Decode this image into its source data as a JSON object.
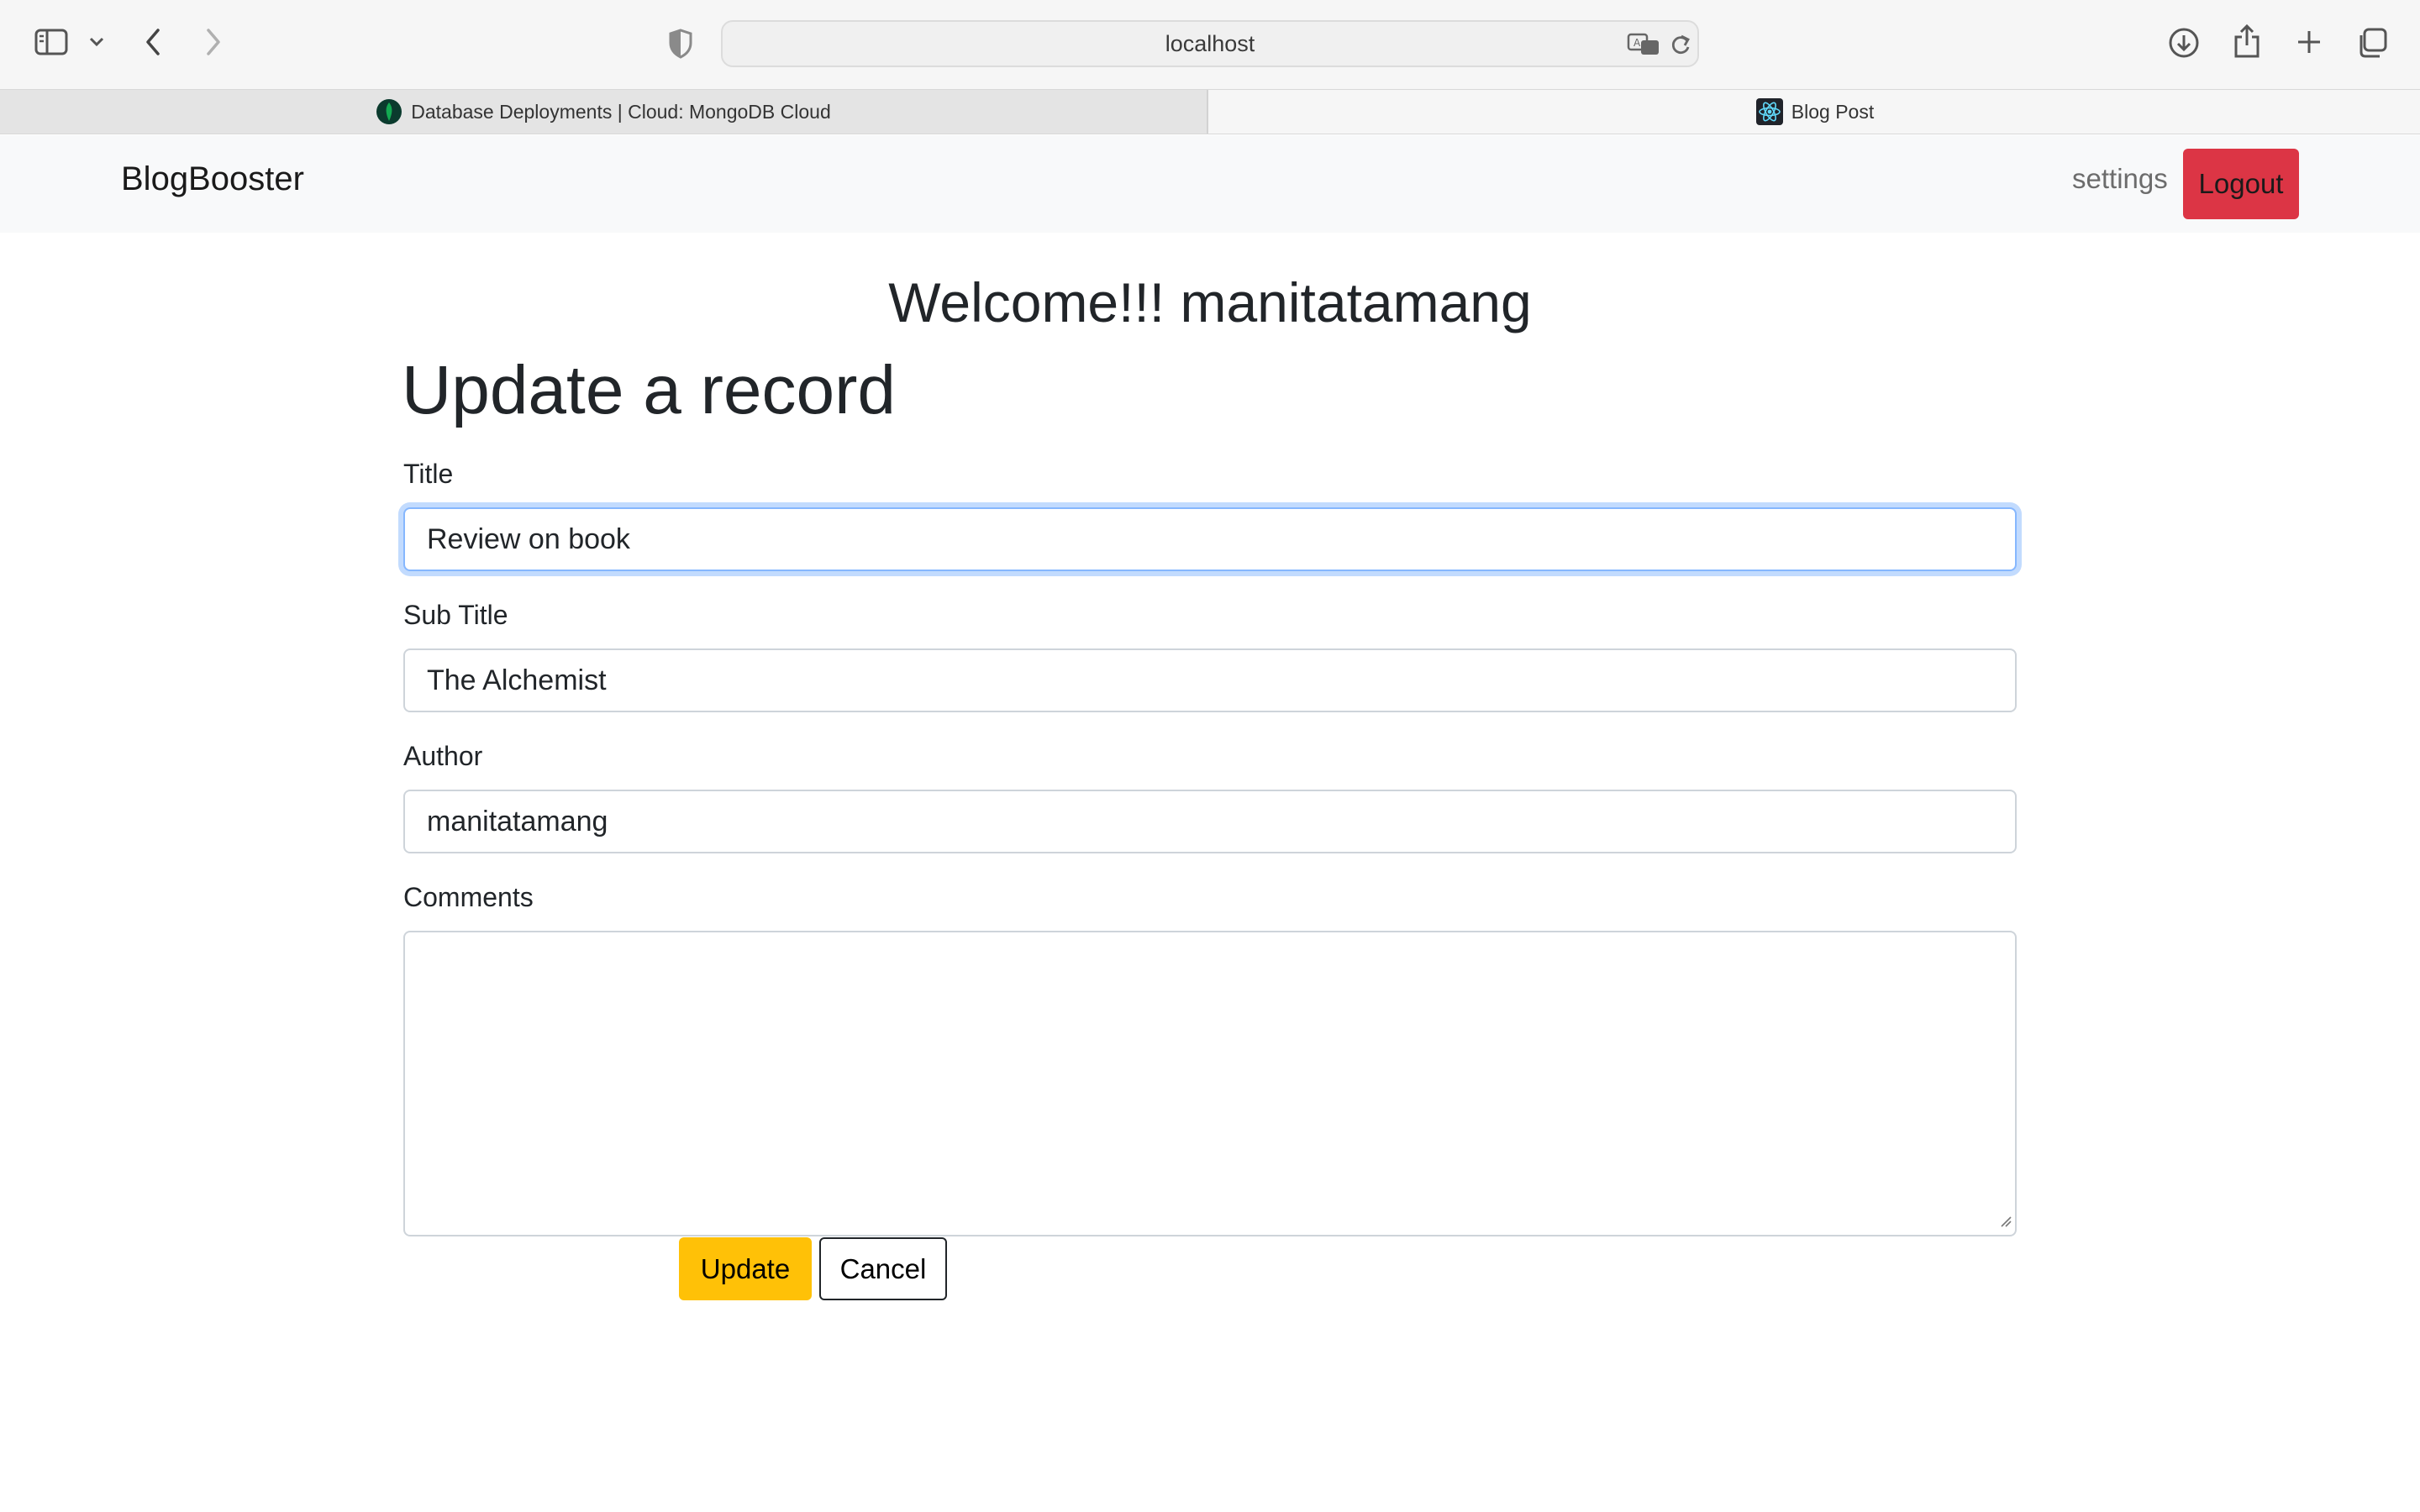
{
  "browser": {
    "url": "localhost",
    "toolbar_icons": [
      "sidebar-icon",
      "chevron-down-icon",
      "back-icon",
      "forward-icon",
      "shield-icon",
      "translate-icon",
      "reload-icon",
      "download-icon",
      "share-icon",
      "plus-icon",
      "tabs-overview-icon"
    ],
    "tabs": [
      {
        "label": "Database Deployments | Cloud: MongoDB Cloud",
        "favicon": "mongodb-leaf-icon",
        "active": false
      },
      {
        "label": "Blog Post",
        "favicon": "react-logo-icon",
        "active": true
      }
    ]
  },
  "navbar": {
    "brand": "BlogBooster",
    "settings_label": "settings",
    "logout_label": "Logout",
    "logout_color": "#dc3545"
  },
  "page": {
    "welcome": "Welcome!!! manitatamang",
    "title": "Update a record"
  },
  "form": {
    "title": {
      "label": "Title",
      "value": "Review on book"
    },
    "subtitle": {
      "label": "Sub Title",
      "value": "The Alchemist"
    },
    "author": {
      "label": "Author",
      "value": "manitatamang"
    },
    "comments": {
      "label": "Comments",
      "value": ""
    },
    "update_label": "Update",
    "cancel_label": "Cancel",
    "update_color": "#ffc107",
    "focus_color": "#86b7fe"
  }
}
